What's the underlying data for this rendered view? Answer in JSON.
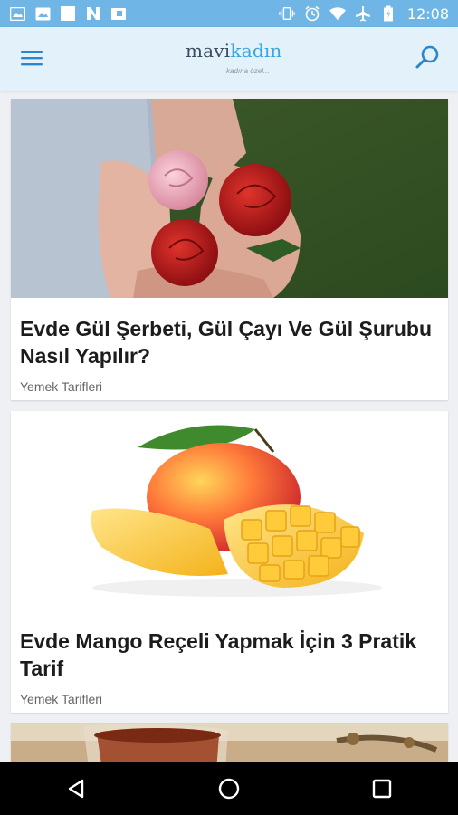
{
  "status_bar": {
    "time": "12:08",
    "left_icons": [
      "image-icon",
      "image-icon",
      "blank-notification-icon",
      "n-notification-icon",
      "package-icon"
    ],
    "right_icons": [
      "vibrate-icon",
      "alarm-icon",
      "wifi-icon",
      "airplane-icon",
      "battery-icon"
    ]
  },
  "app_bar": {
    "logo_mavi": "mavi",
    "logo_kadin": "kadın",
    "logo_tagline": "kadına özel...",
    "menu_icon": "hamburger-menu-icon",
    "search_icon": "search-icon"
  },
  "articles": [
    {
      "title": "Evde Gül Şerbeti, Gül Çayı Ve Gül Şurubu Nasıl Yapılır?",
      "category": "Yemek Tarifleri",
      "image": "roses-in-hands-photo"
    },
    {
      "title": "Evde Mango Reçeli Yapmak İçin 3 Pratik Tarif",
      "category": "Yemek Tarifleri",
      "image": "mango-fruit-photo"
    },
    {
      "title": "",
      "category": "",
      "image": "tea-glasses-photo"
    }
  ],
  "nav_bar": {
    "icons": [
      "back-icon",
      "home-icon",
      "recents-icon"
    ]
  },
  "colors": {
    "status_bar": "#6fb6e6",
    "app_bar": "#e3f1fb",
    "accent": "#3aa3e2",
    "background": "#eef0f3"
  }
}
